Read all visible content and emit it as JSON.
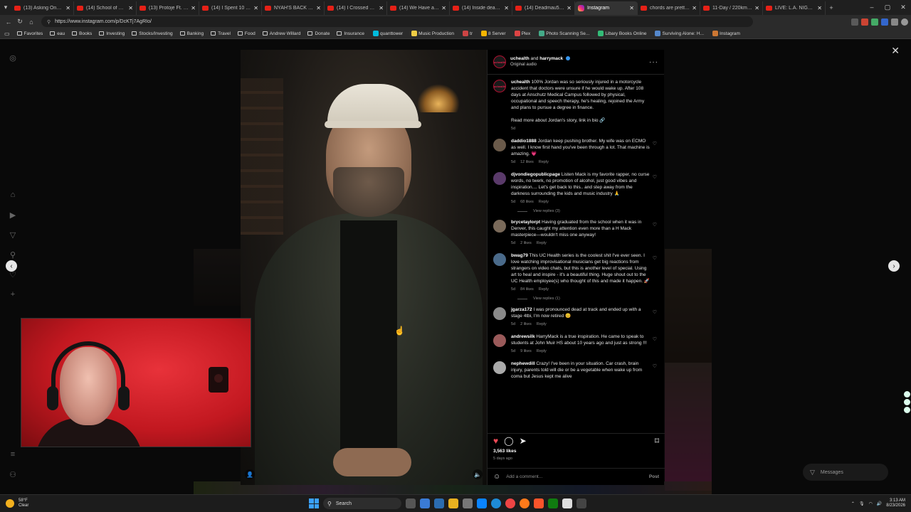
{
  "tabs": [
    {
      "label": "(13) Asking One of th",
      "kind": "yt"
    },
    {
      "label": "(14) School of Hard K",
      "kind": "yt"
    },
    {
      "label": "(13) Protoje Ft. Stephe",
      "kind": "yt"
    },
    {
      "label": "(14) I Spent 10 Years",
      "kind": "yt"
    },
    {
      "label": "NYAH'S BACK ON T",
      "kind": "yt"
    },
    {
      "label": "(14) I Crossed an Oce",
      "kind": "yt"
    },
    {
      "label": "(14) We Have a Huge",
      "kind": "yt"
    },
    {
      "label": "(14) Inside deadmau5",
      "kind": "yt"
    },
    {
      "label": "(14) Deadmau5 disco",
      "kind": "yt"
    },
    {
      "label": "Instagram",
      "kind": "ig",
      "active": true
    },
    {
      "label": "chords are pretty eas",
      "kind": "yt"
    },
    {
      "label": "11-Day / 220km Solo",
      "kind": "yt"
    },
    {
      "label": "LIVE: L.A. NIGHTCH",
      "kind": "yt"
    }
  ],
  "address": {
    "url": "https://www.instagram.com/p/DcKTj7AgRIo/"
  },
  "bookmarks": [
    "Favorites",
    "eau",
    "Books",
    "Investing",
    "Stocks/Investing",
    "Banking",
    "Travel",
    "Food",
    "Andrew Willard",
    "Donate",
    "Insurance",
    "quanttower",
    "Music Production",
    "tr",
    "8 Server",
    "Plex",
    "Photo Scanning Se...",
    "Libary Books Online",
    "Surviving Alone: H...",
    "Instagram"
  ],
  "post": {
    "author": "uchealth",
    "and_word": "and",
    "collab": "harrymack",
    "audio": "Original audio",
    "caption_user": "uchealth",
    "caption_text": "100% Jordan was so seriously injured in a motorcycle accident that doctors were unsure if he would wake up. After 108 days at Anschutz Medical Campus followed by physical, occupational and speech therapy, he's healing, rejoined the Army and plans to pursue a degree in finance.",
    "caption_more": "Read more about Jordan's story, link in bio 🔗",
    "caption_age": "5d",
    "likes": "3,563 likes",
    "ago": "5 days ago",
    "add_comment_placeholder": "Add a comment...",
    "post_label": "Post",
    "avatar_text": "uchealth"
  },
  "comments": [
    {
      "user": "daddio1888",
      "text": "Jordan keep pushing brother. My wife was on ECMO as well. I know first hand you've been through a lot. That machine is amazing. 💗",
      "age": "5d",
      "likes": "12 likes",
      "reply": "Reply",
      "replies": null
    },
    {
      "user": "djvondiegopublicpage",
      "text": "Listen Mack is my favorite rapper, no curse words, no twerk, no promotion of alcohol, just good vibes and inspiration.... Let's get back to this.. and step away from the darkness surrounding the kids and music industry 🙏",
      "age": "5d",
      "likes": "68 likes",
      "reply": "Reply",
      "replies": "View replies (3)"
    },
    {
      "user": "brycetaylorpt",
      "text": "Having graduated from the school when it was in Denver, this caught my attention even more than a H Mack masterpiece—wouldn't miss one anyway!",
      "age": "5d",
      "likes": "2 likes",
      "reply": "Reply",
      "replies": null
    },
    {
      "user": "bwag79",
      "text": "This UC Health series is the coolest shit I've ever seen. I love watching improvisational musicians get big reactions from strangers on video chats, but this is another level of special. Using art to heal and inspire - it's a beautiful thing. Huge shout out to the UC Health employee(s) who thought of this and made it happen. 🚀",
      "age": "5d",
      "likes": "84 likes",
      "reply": "Reply",
      "replies": "View replies (1)"
    },
    {
      "user": "jgarza172",
      "text": "I was pronounced dead at track and ended up with a stage 4tbi, I'm now retired 😊",
      "age": "5d",
      "likes": "2 likes",
      "reply": "Reply",
      "replies": null
    },
    {
      "user": "andrewsilk",
      "text": "HarryMack is a true inspiration. He came to speak to students at John Muir HS about 10 years ago and just as strong !!!",
      "age": "5d",
      "likes": "9 likes",
      "reply": "Reply",
      "replies": null
    },
    {
      "user": "nephewdill",
      "text": "Crazy! I've been in your situation. Car crash, brain injury, parents told will die or be a vegetable when wake up from coma but Jesus kept me alive",
      "age": "",
      "likes": "",
      "reply": "",
      "replies": null
    }
  ],
  "messages_label": "Messages",
  "taskbar": {
    "temp": "58°F",
    "condition": "Clear",
    "search": "Search",
    "time": "3:13 AM",
    "date": "8/23/2026"
  },
  "colors": {
    "like_red": "#ed4956",
    "verified_blue": "#3897f0",
    "webcam_red": "#d41e26"
  }
}
